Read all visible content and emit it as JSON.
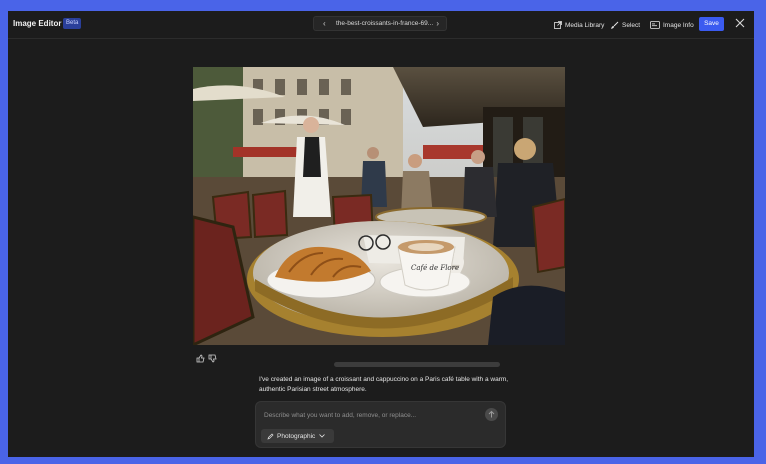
{
  "header": {
    "title": "Image Editor",
    "badge": "Beta",
    "filename": "the-best-croissants-in-france-69...",
    "prev_glyph": "‹",
    "next_glyph": "›",
    "tools": {
      "media_library": "Media Library",
      "select": "Select",
      "image_info": "Image Info"
    },
    "save_label": "Save"
  },
  "chat": {
    "assistant_message": "I've created an image of a croissant and cappuccino on a Paris café table with a warm, authentic Parisian street atmosphere."
  },
  "prompt": {
    "placeholder": "Describe what you want to add, remove, or replace...",
    "style_label": "Photographic"
  },
  "image": {
    "cup_lettering": "Café de Flore"
  },
  "colors": {
    "accent": "#3b5bf0",
    "frame": "#4a64e8",
    "background": "#1c1c1c"
  }
}
